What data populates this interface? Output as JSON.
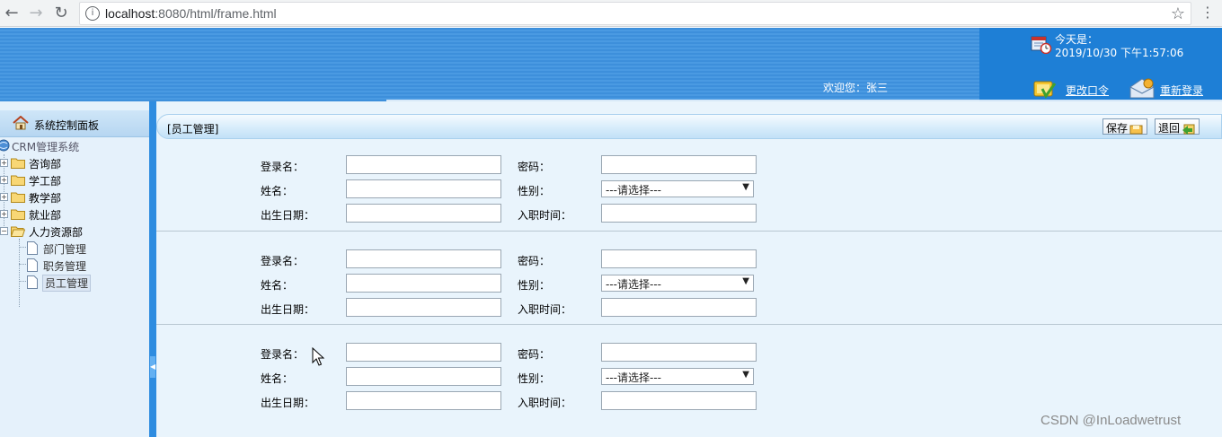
{
  "browser": {
    "back": "←",
    "forward": "→",
    "reload": "↻",
    "url_host": "localhost",
    "url_rest": ":8080/html/frame.html",
    "info": "i",
    "star": "☆",
    "menu": "⋮"
  },
  "header": {
    "date_label": "今天是：",
    "date_value": "2019/10/30 下午1:57:06",
    "welcome": "欢迎您：张三",
    "change_password": "更改口令",
    "relogin": "重新登录"
  },
  "sidebar": {
    "title": "系统控制面板",
    "root": "CRM管理系统",
    "departments": [
      "咨询部",
      "学工部",
      "教学部",
      "就业部",
      "人力资源部"
    ],
    "hr_pages": [
      "部门管理",
      "职务管理",
      "员工管理"
    ],
    "selected": "员工管理"
  },
  "main": {
    "breadcrumb": "[员工管理]",
    "save": "保存",
    "back": "退回",
    "labels": {
      "login": "登录名：",
      "password": "密码：",
      "name": "姓名：",
      "gender": "性别：",
      "birth": "出生日期：",
      "hire": "入职时间："
    },
    "gender_select": "---请选择---",
    "sections": [
      {
        "login": "",
        "password": "",
        "name": "",
        "gender": "---请选择---",
        "birth": "",
        "hire": ""
      },
      {
        "login": "",
        "password": "",
        "name": "",
        "gender": "---请选择---",
        "birth": "",
        "hire": ""
      },
      {
        "login": "",
        "password": "",
        "name": "",
        "gender": "---请选择---",
        "birth": "",
        "hire": ""
      }
    ]
  },
  "watermark": "CSDN @InLoadwetrust",
  "colors": {
    "banner": "#3d8fdb",
    "sidebar": "#e5f1fb",
    "main": "#e9f4fc",
    "splitter": "#2e8ce0"
  }
}
